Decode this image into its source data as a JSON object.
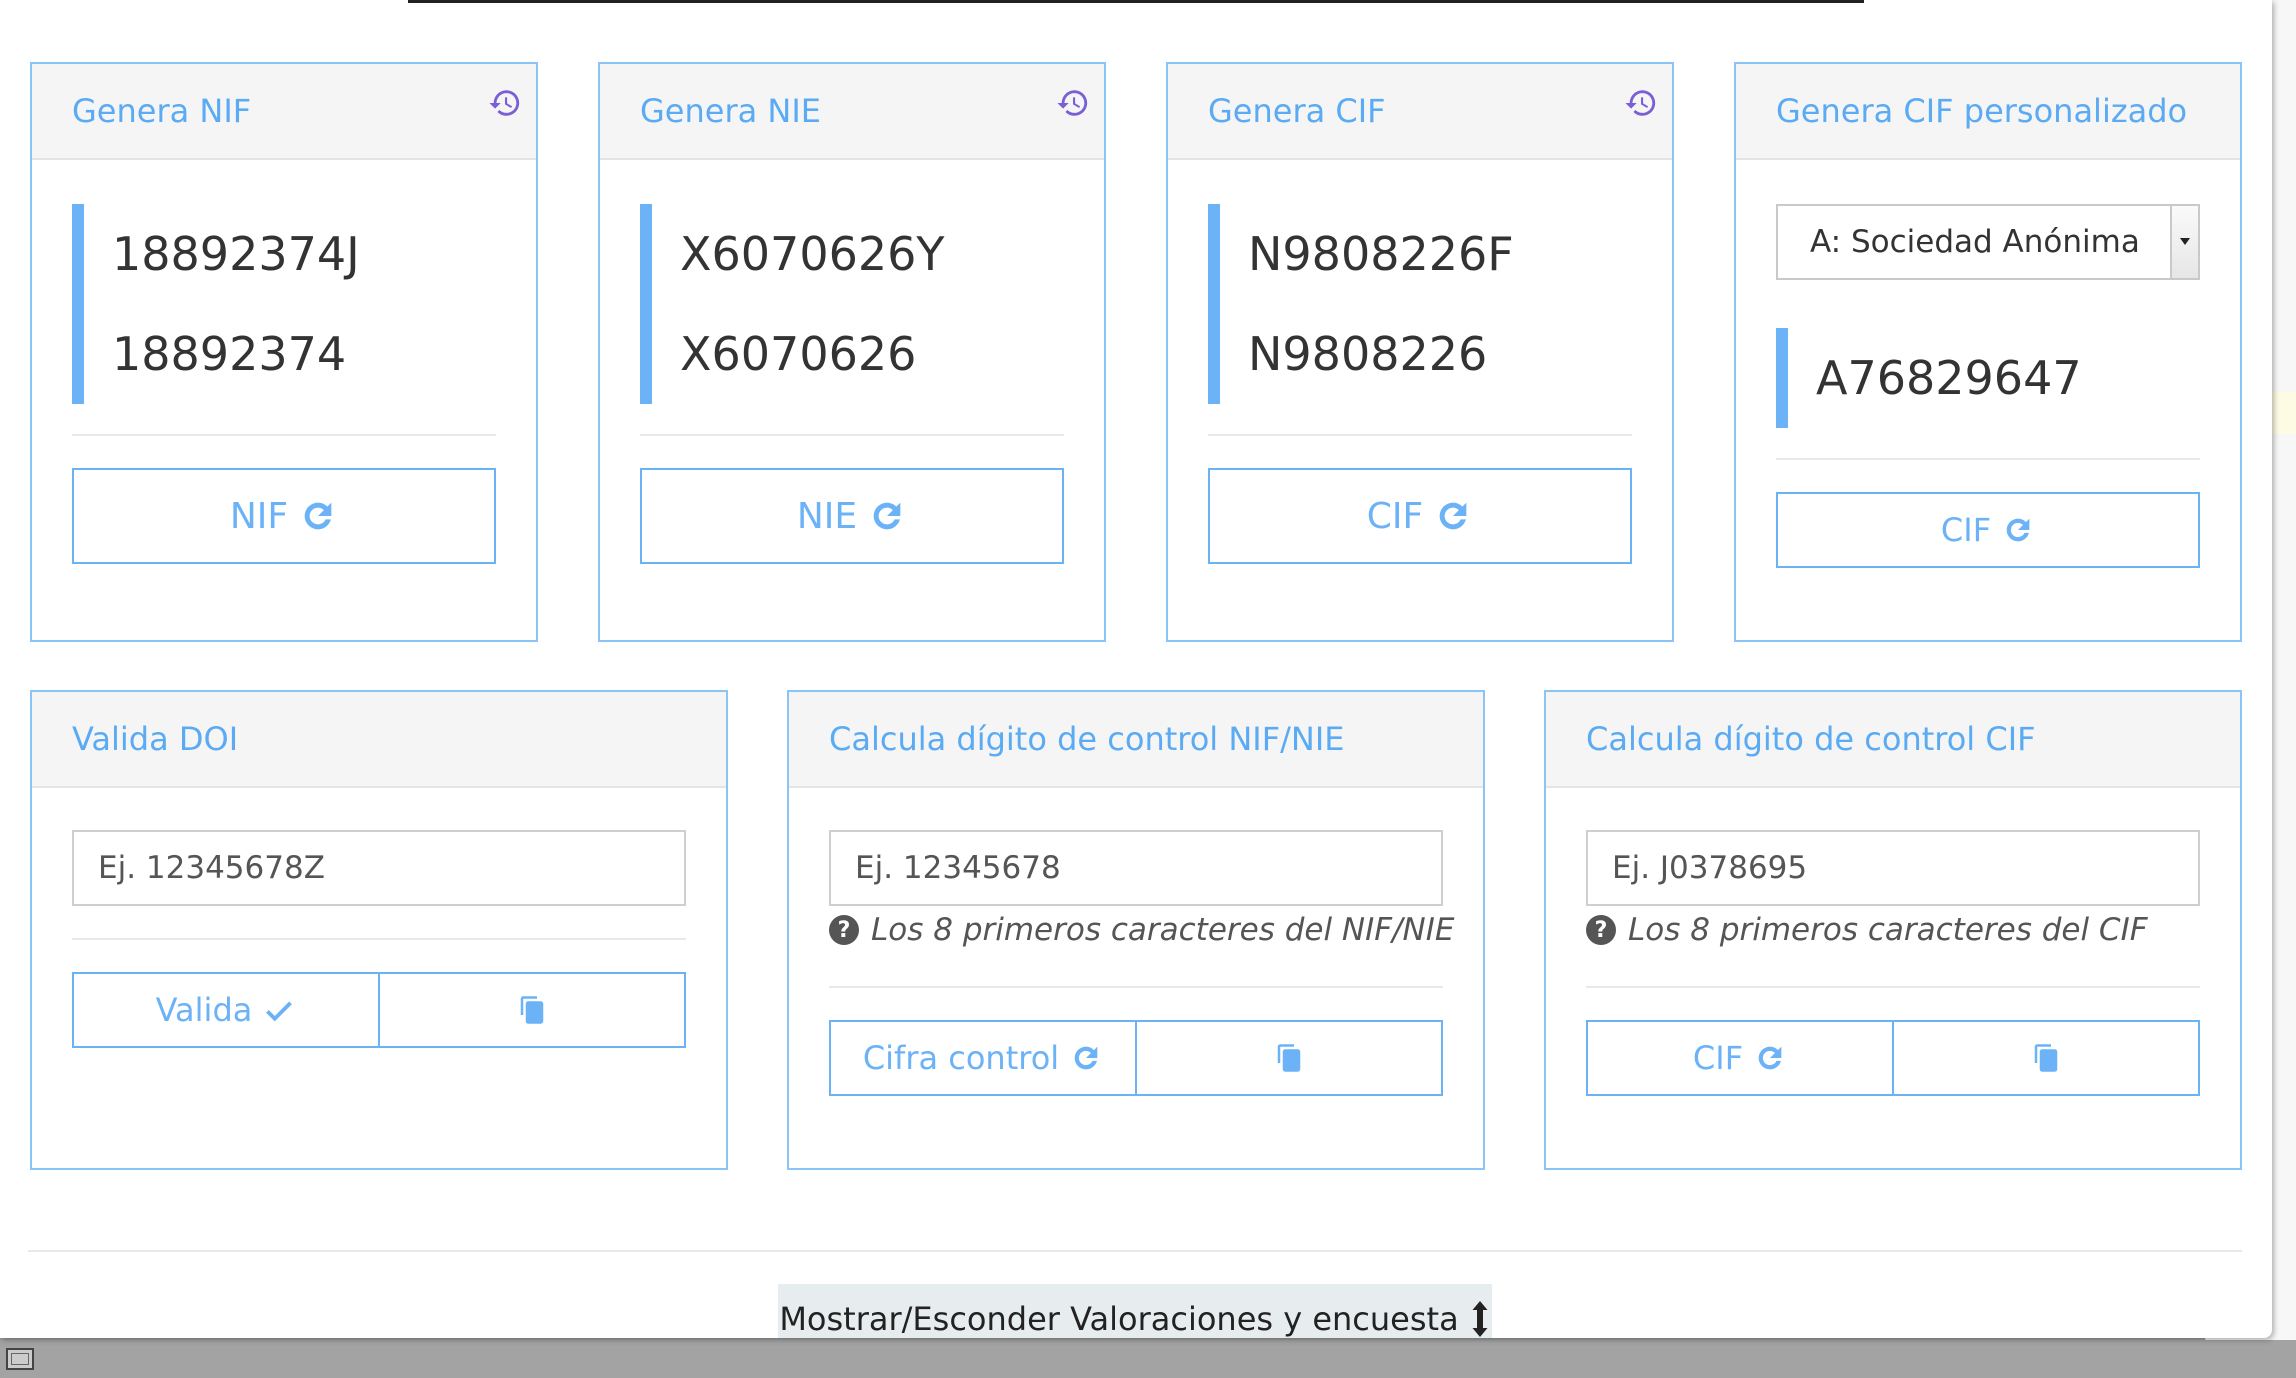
{
  "background_fragments": [
    "lu",
    "ul",
    "ul",
    "ul"
  ],
  "cards": {
    "nif": {
      "title": "Genera NIF",
      "value_full": "18892374J",
      "value_short": "18892374",
      "button": "NIF"
    },
    "nie": {
      "title": "Genera NIE",
      "value_full": "X6070626Y",
      "value_short": "X6070626",
      "button": "NIE"
    },
    "cif": {
      "title": "Genera CIF",
      "value_full": "N9808226F",
      "value_short": "N9808226",
      "button": "CIF"
    },
    "cif_custom": {
      "title": "Genera CIF personalizado",
      "select_value": "A: Sociedad Anónima",
      "value": "A76829647",
      "button": "CIF"
    }
  },
  "validate": {
    "title": "Valida DOI",
    "placeholder": "Ej. 12345678Z",
    "button": "Valida"
  },
  "control_nif": {
    "title": "Calcula dígito de control NIF/NIE",
    "placeholder": "Ej. 12345678",
    "hint": "Los 8 primeros caracteres del NIF/NIE",
    "button": "Cifra control"
  },
  "control_cif": {
    "title": "Calcula dígito de control CIF",
    "placeholder": "Ej. J0378695",
    "hint": "Los 8 primeros caracteres del CIF",
    "button": "CIF"
  },
  "footer": {
    "toggle_label": "Mostrar/Esconder Valoraciones y encuesta"
  },
  "colors": {
    "accent": "#6cb2f6",
    "title_blue": "#5aabf4",
    "history_purple": "#7b5fd6"
  },
  "icons": [
    "history-icon",
    "refresh-icon",
    "check-icon",
    "copy-icon",
    "question-icon",
    "vertical-arrows-icon"
  ]
}
